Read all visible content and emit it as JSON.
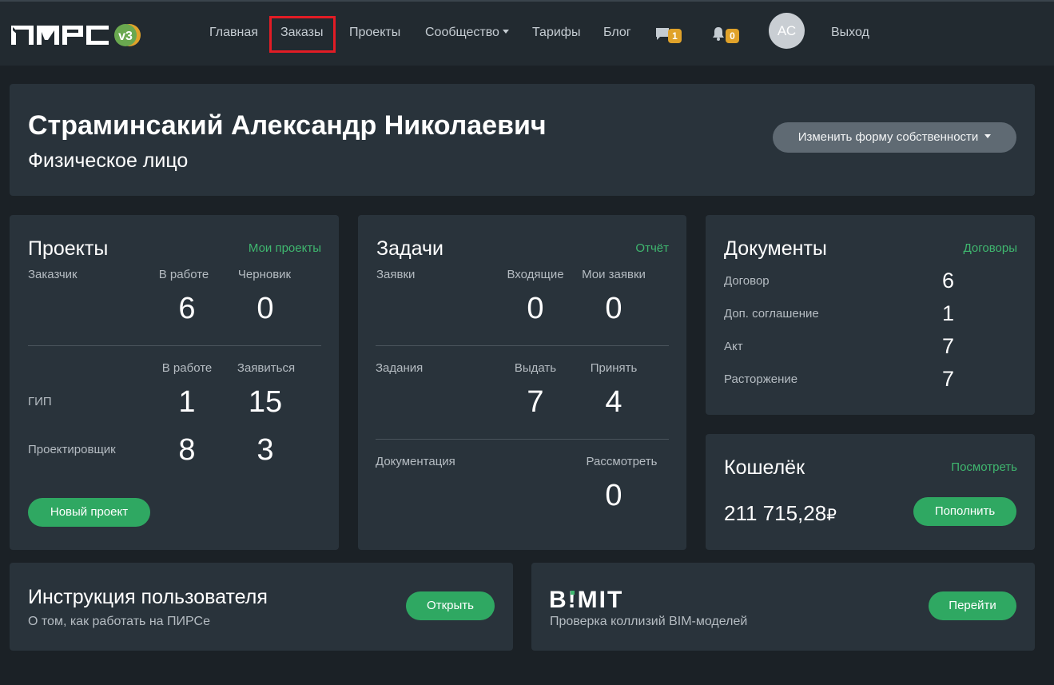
{
  "brand": {
    "logo_text": "ПИРС",
    "version": "v3"
  },
  "nav": {
    "home": "Главная",
    "orders": "Заказы",
    "projects": "Проекты",
    "community": "Сообщество",
    "tariffs": "Тарифы",
    "blog": "Блог",
    "messages_count": "1",
    "notifications_count": "0",
    "avatar_initials": "АС",
    "logout": "Выход"
  },
  "header": {
    "name": "Страминсакий Александр Николаевич",
    "entity_type": "Физическое лицо",
    "change_ownership_button": "Изменить форму собственности"
  },
  "projects_card": {
    "title": "Проекты",
    "link": "Мои проекты",
    "customer_label": "Заказчик",
    "col_in_work": "В работе",
    "col_draft": "Черновик",
    "customer_in_work": "6",
    "customer_draft": "0",
    "col_in_work_2": "В работе",
    "col_apply": "Заявиться",
    "gip_label": "ГИП",
    "gip_in_work": "1",
    "gip_apply": "15",
    "designer_label": "Проектировщик",
    "designer_in_work": "8",
    "designer_apply": "3",
    "new_project_button": "Новый проект"
  },
  "tasks_card": {
    "title": "Задачи",
    "link": "Отчёт",
    "requests_label": "Заявки",
    "col_incoming": "Входящие",
    "col_my_requests": "Мои заявки",
    "incoming": "0",
    "my_requests": "0",
    "assignments_label": "Задания",
    "col_issue": "Выдать",
    "col_accept": "Принять",
    "issue": "7",
    "accept": "4",
    "documentation_label": "Документация",
    "col_review": "Рассмотреть",
    "review": "0"
  },
  "documents_card": {
    "title": "Документы",
    "link": "Договоры",
    "items": [
      {
        "label": "Договор",
        "value": "6"
      },
      {
        "label": "Доп. соглашение",
        "value": "1"
      },
      {
        "label": "Акт",
        "value": "7"
      },
      {
        "label": "Расторжение",
        "value": "7"
      }
    ]
  },
  "wallet_card": {
    "title": "Кошелёк",
    "link": "Посмотреть",
    "amount": "211 715,28",
    "currency": "₽",
    "topup_button": "Пополнить"
  },
  "instruction_card": {
    "title": "Инструкция пользователя",
    "subtitle": "О том, как работать на ПИРСе",
    "open_button": "Открыть"
  },
  "bimit_card": {
    "logo_text": "B!MIT",
    "subtitle": "Проверка коллизий BIM-моделей",
    "go_button": "Перейти"
  },
  "colors": {
    "accent_green": "#2fa862",
    "link_green": "#3fb76f",
    "badge_orange": "#e0a22a",
    "active_outline": "#e21c25"
  }
}
